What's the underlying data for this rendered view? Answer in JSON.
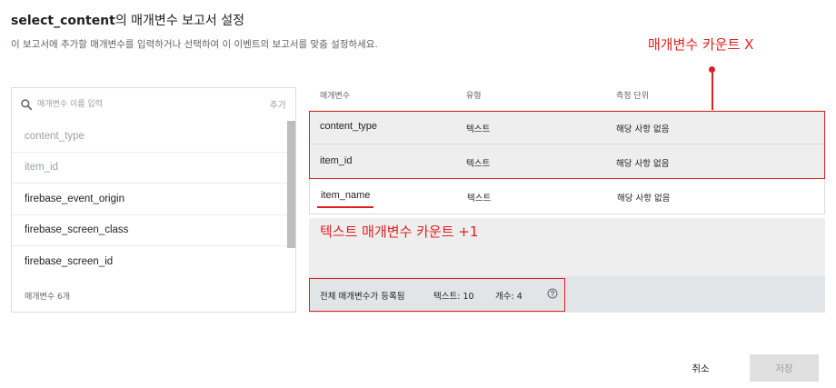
{
  "dialog": {
    "title_bold": "select_content",
    "title_rest": "의 매개변수 보고서 설정",
    "subtitle": "이 보고서에 추가할 매개변수를 입력하거나 선택하여 이 이벤트의 보고서를 맞춤 설정하세요."
  },
  "annotations": {
    "top": "매개변수 카운트 X",
    "middle": "텍스트 매개변수 카운트 +1",
    "color": "#e02020"
  },
  "left_panel": {
    "search_placeholder": "매개변수 이름 입력",
    "add_label": "추가",
    "items": [
      {
        "label": "content_type",
        "state": "used"
      },
      {
        "label": "item_id",
        "state": "used"
      },
      {
        "label": "firebase_event_origin",
        "state": "available"
      },
      {
        "label": "firebase_screen_class",
        "state": "available"
      },
      {
        "label": "firebase_screen_id",
        "state": "available"
      }
    ],
    "count_label": "매개변수 6개"
  },
  "table": {
    "headers": {
      "param": "매개변수",
      "type": "유형",
      "unit": "측정 단위"
    },
    "rows": [
      {
        "param": "content_type",
        "type": "텍스트",
        "unit": "해당 사항 없음"
      },
      {
        "param": "item_id",
        "type": "텍스트",
        "unit": "해당 사항 없음"
      },
      {
        "param": "item_name",
        "type": "텍스트",
        "unit": "해당 사항 없음"
      }
    ],
    "footer": {
      "registered": "전체 매개변수가 등록됨",
      "text_count": "텍스트: 10",
      "number_count": "개수: 4"
    }
  },
  "buttons": {
    "cancel": "취소",
    "save": "저장"
  }
}
